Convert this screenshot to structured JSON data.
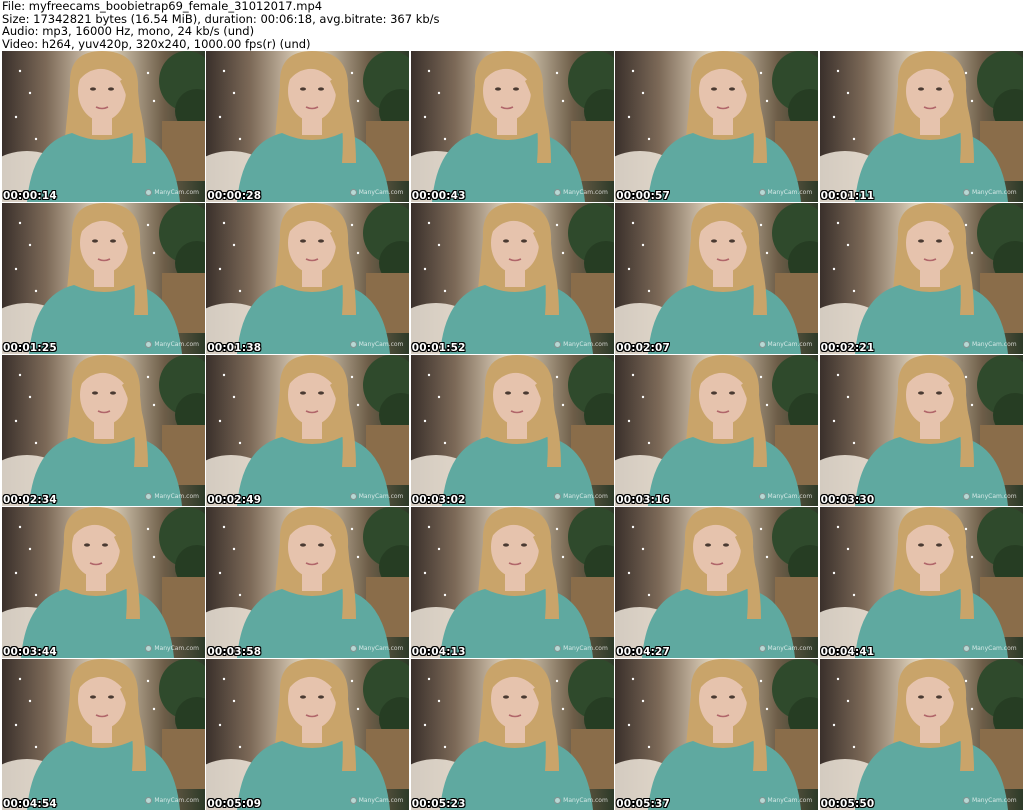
{
  "header": {
    "file_line": "File: myfreecams_boobietrap69_female_31012017.mp4",
    "size_line": "Size: 17342821 bytes (16.54 MiB), duration: 00:06:18, avg.bitrate: 367 kb/s",
    "audio_line": "Audio: mp3, 16000 Hz, mono, 24 kb/s (und)",
    "video_line": "Video: h264, yuv420p, 320x240, 1000.00 fps(r) (und)"
  },
  "watermark": "ManyCam.com",
  "colors": {
    "shirt": "#5fa9a0",
    "hair": "#c9a46a",
    "skin": "#e6c3ad",
    "plant": "#2f4a2c",
    "wall": "#e9ddc6"
  },
  "thumbnails": [
    {
      "timestamp": "00:00:14"
    },
    {
      "timestamp": "00:00:28"
    },
    {
      "timestamp": "00:00:43"
    },
    {
      "timestamp": "00:00:57"
    },
    {
      "timestamp": "00:01:11"
    },
    {
      "timestamp": "00:01:25"
    },
    {
      "timestamp": "00:01:38"
    },
    {
      "timestamp": "00:01:52"
    },
    {
      "timestamp": "00:02:07"
    },
    {
      "timestamp": "00:02:21"
    },
    {
      "timestamp": "00:02:34"
    },
    {
      "timestamp": "00:02:49"
    },
    {
      "timestamp": "00:03:02"
    },
    {
      "timestamp": "00:03:16"
    },
    {
      "timestamp": "00:03:30"
    },
    {
      "timestamp": "00:03:44"
    },
    {
      "timestamp": "00:03:58"
    },
    {
      "timestamp": "00:04:13"
    },
    {
      "timestamp": "00:04:27"
    },
    {
      "timestamp": "00:04:41"
    },
    {
      "timestamp": "00:04:54"
    },
    {
      "timestamp": "00:05:09"
    },
    {
      "timestamp": "00:05:23"
    },
    {
      "timestamp": "00:05:37"
    },
    {
      "timestamp": "00:05:50"
    }
  ]
}
